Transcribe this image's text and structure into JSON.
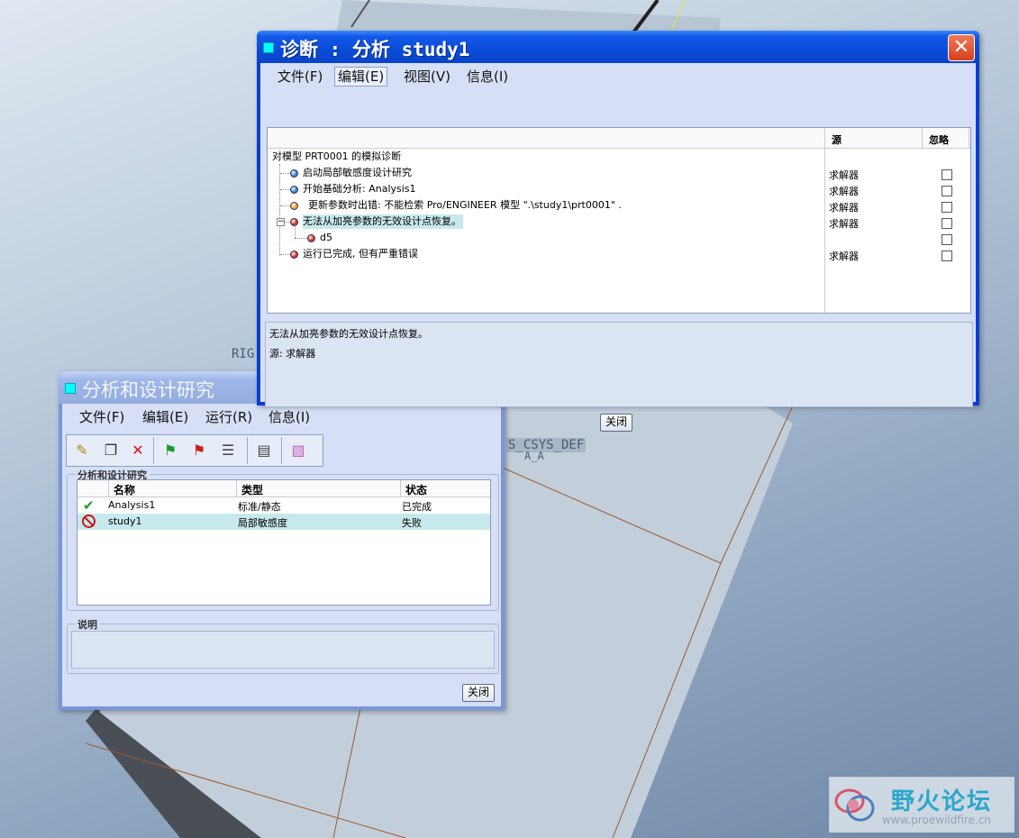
{
  "viewport": {
    "labels": {
      "rig": "RIG",
      "csys": "S_CSYS_DEF",
      "a": "A_A"
    }
  },
  "watermark": {
    "title": "野火论坛",
    "url": "www.proewildfire.cn"
  },
  "diagnostic_window": {
    "title": "诊断 : 分析 study1",
    "menus": [
      "文件(F)",
      "编辑(E)",
      "视图(V)",
      "信息(I)"
    ],
    "selected_menu": "编辑(E)",
    "columns": {
      "source": "源",
      "ignore": "忽略"
    },
    "root": "对模型 PRT0001 的模拟诊断",
    "messages": [
      {
        "text": "启动局部敏感度设计研究",
        "source": "求解器",
        "status": "info",
        "color": "#2d7fe0"
      },
      {
        "text": "开始基础分析: Analysis1",
        "source": "求解器",
        "status": "info",
        "color": "#2d7fe0"
      },
      {
        "text": "更新参数时出错: 不能检索 Pro/ENGINEER 模型 \".\\study1\\prt0001\" .",
        "source": "求解器",
        "status": "warning",
        "color": "#f0a030"
      },
      {
        "text": "无法从加亮参数的无效设计点恢复。",
        "source": "求解器",
        "status": "error",
        "color": "#d8322a",
        "highlighted": true
      },
      {
        "text": "d5",
        "source": "",
        "status": "error",
        "color": "#d8322a",
        "child": true
      },
      {
        "text": "运行已完成, 但有严重错误",
        "source": "求解器",
        "status": "error",
        "color": "#d8322a"
      }
    ],
    "detail": {
      "message": "无法从加亮参数的无效设计点恢复。",
      "source_line": "源: 求解器"
    },
    "close_label": "关闭"
  },
  "analysis_window": {
    "title": "分析和设计研究",
    "menus": [
      "文件(F)",
      "编辑(E)",
      "运行(R)",
      "信息(I)"
    ],
    "toolbar_icons": [
      "edit-pencil-icon",
      "copy-icon",
      "delete-x-icon",
      "run-green-flag-icon",
      "stop-red-flag-icon",
      "list-icon",
      "report-icon",
      "display-result-icon"
    ],
    "group_label": "分析和设计研究",
    "columns": [
      "名称",
      "类型",
      "状态"
    ],
    "studies": [
      {
        "name": "Analysis1",
        "type": "标准/静态",
        "status": "已完成",
        "icon": "check-icon"
      },
      {
        "name": "study1",
        "type": "局部敏感度",
        "status": "失败",
        "icon": "failed-icon",
        "selected": true
      }
    ],
    "description_label": "说明",
    "description_value": "",
    "close_label": "关闭"
  },
  "colors": {
    "titlebar_blue": "#0a4cd8",
    "window_body": "#d6dff5",
    "highlight": "#c8e9ec",
    "close_red": "#d8401c"
  }
}
